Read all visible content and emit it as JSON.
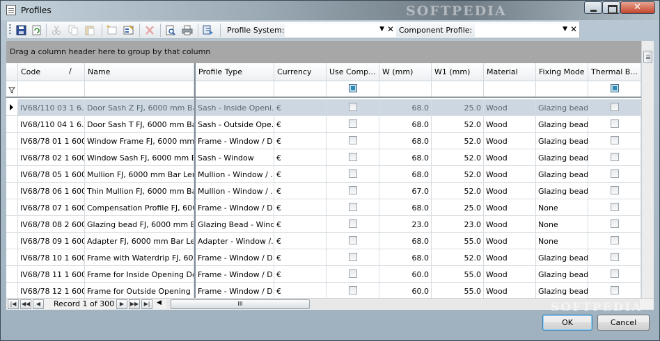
{
  "window": {
    "title": "Profiles",
    "watermark": "SOFTPEDIA"
  },
  "toolbar": {
    "profile_system_label": "Profile System:",
    "profile_system_value": "",
    "component_profile_label": "Component Profile:",
    "component_profile_value": ""
  },
  "group_hint": "Drag a column header here to group by that column",
  "grid": {
    "columns": [
      "Code",
      "Name",
      "Profile Type",
      "Currency",
      "Use Comp...",
      "W (mm)",
      "W1 (mm)",
      "Material",
      "Fixing Mode",
      "Thermal B..."
    ],
    "sort_indicator": "/",
    "rows": [
      {
        "code": "IV68/110 03 1 6...",
        "name": "Door Sash Z FJ, 6000 mm Ba...",
        "type": "Sash - Inside Openi...",
        "currency": "€",
        "w": "68.0",
        "w1": "25.0",
        "material": "Wood",
        "fixing": "Glazing bead",
        "selected": true
      },
      {
        "code": "IV68/110 04 1 6...",
        "name": "Door Sash T FJ, 6000 mm Ba...",
        "type": "Sash - Outside Ope...",
        "currency": "€",
        "w": "68.0",
        "w1": "52.0",
        "material": "Wood",
        "fixing": "Glazing bead"
      },
      {
        "code": "IV68/78 01 1 6000",
        "name": "Window Frame FJ, 6000 mm ...",
        "type": "Frame - Window / D...",
        "currency": "€",
        "w": "68.0",
        "w1": "52.0",
        "material": "Wood",
        "fixing": "Glazing bead"
      },
      {
        "code": "IV68/78 02 1 6000",
        "name": "Window Sash FJ, 6000 mm B...",
        "type": "Sash - Window",
        "currency": "€",
        "w": "68.0",
        "w1": "52.0",
        "material": "Wood",
        "fixing": "Glazing bead"
      },
      {
        "code": "IV68/78 05 1 6000",
        "name": "Mullion FJ, 6000 mm Bar Length",
        "type": "Mullion - Window / ...",
        "currency": "€",
        "w": "68.0",
        "w1": "52.0",
        "material": "Wood",
        "fixing": "Glazing bead"
      },
      {
        "code": "IV68/78 06 1 6000",
        "name": "Thin Mullion FJ, 6000 mm Bar...",
        "type": "Mullion - Window / ...",
        "currency": "€",
        "w": "67.0",
        "w1": "52.0",
        "material": "Wood",
        "fixing": "Glazing bead"
      },
      {
        "code": "IV68/78 07 1 6000",
        "name": "Compensation Profile FJ, 600...",
        "type": "Frame - Window / D...",
        "currency": "€",
        "w": "68.0",
        "w1": "25.0",
        "material": "Wood",
        "fixing": "None"
      },
      {
        "code": "IV68/78 08 2 6000",
        "name": "Glazing bead FJ, 6000 mm B...",
        "type": "Glazing Bead - Wind...",
        "currency": "€",
        "w": "23.0",
        "w1": "23.0",
        "material": "Wood",
        "fixing": "None"
      },
      {
        "code": "IV68/78 09 1 6000",
        "name": "Adapter FJ, 6000 mm Bar Le...",
        "type": "Adapter - Window /...",
        "currency": "€",
        "w": "68.0",
        "w1": "55.0",
        "material": "Wood",
        "fixing": "None"
      },
      {
        "code": "IV68/78 10 1 6000",
        "name": "Frame with Waterdrip FJ, 60...",
        "type": "Frame - Window / D...",
        "currency": "€",
        "w": "68.0",
        "w1": "52.0",
        "material": "Wood",
        "fixing": "Glazing bead"
      },
      {
        "code": "IV68/78 11 1 6000",
        "name": "Frame for Inside Opening Do...",
        "type": "Frame - Window / D...",
        "currency": "€",
        "w": "60.0",
        "w1": "55.0",
        "material": "Wood",
        "fixing": "Glazing bead"
      },
      {
        "code": "IV68/78 12 1 6000",
        "name": "Frame for Outside Opening ...",
        "type": "Frame - Window / D...",
        "currency": "€",
        "w": "60.0",
        "w1": "55.0",
        "material": "Wood",
        "fixing": "Glazing bead"
      }
    ]
  },
  "navigator": {
    "record_text": "Record 1 of 300",
    "scroll_grip": "III"
  },
  "buttons": {
    "ok": "OK",
    "cancel": "Cancel"
  }
}
